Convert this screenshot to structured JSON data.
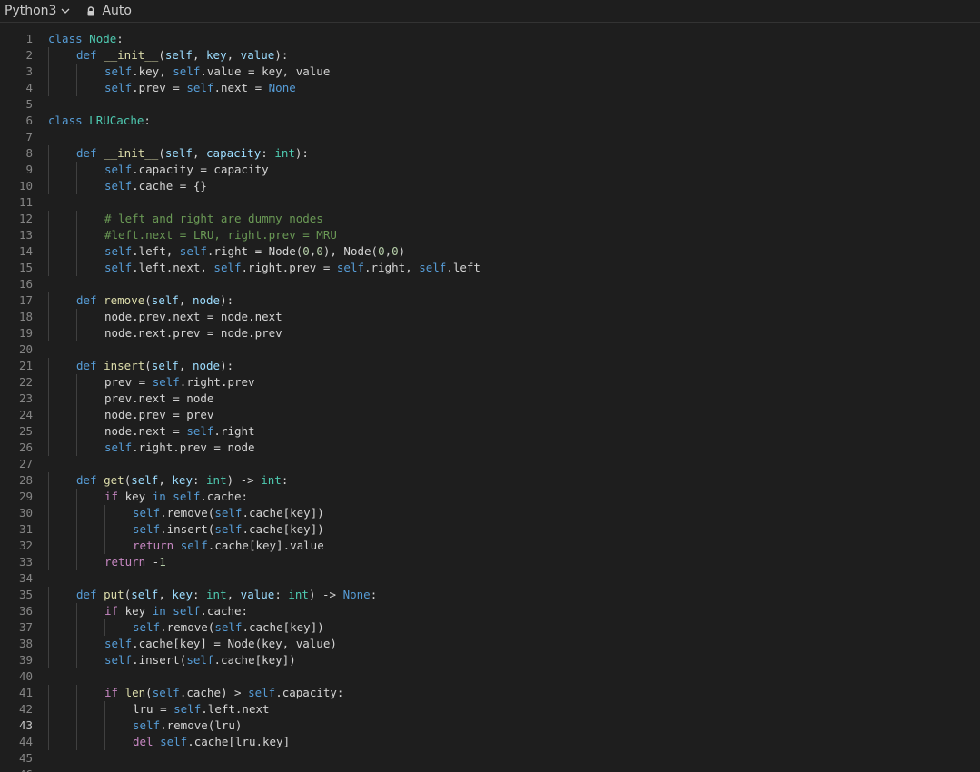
{
  "toolbar": {
    "language": "Python3",
    "mode": "Auto"
  },
  "editor": {
    "active_line": 43,
    "lines": [
      {
        "n": 1,
        "indent": 0,
        "tokens": [
          [
            "kw",
            "class"
          ],
          [
            "",
            ", "
          ],
          [
            "cls",
            "Node"
          ],
          [
            "",
            ":"
          ]
        ]
      },
      {
        "n": 2,
        "indent": 1,
        "tokens": [
          [
            "kw",
            "def"
          ],
          [
            "",
            " "
          ],
          [
            "fn",
            "__init__"
          ],
          [
            "",
            "("
          ],
          [
            "var",
            "self"
          ],
          [
            "",
            ", "
          ],
          [
            "var",
            "key"
          ],
          [
            "",
            ", "
          ],
          [
            "var",
            "value"
          ],
          [
            "",
            "):"
          ]
        ]
      },
      {
        "n": 3,
        "indent": 2,
        "tokens": [
          [
            "self",
            "self"
          ],
          [
            "",
            ".key, "
          ],
          [
            "self",
            "self"
          ],
          [
            "",
            ".value = key, value"
          ]
        ]
      },
      {
        "n": 4,
        "indent": 2,
        "tokens": [
          [
            "self",
            "self"
          ],
          [
            "",
            ".prev = "
          ],
          [
            "self",
            "self"
          ],
          [
            "",
            ".next = "
          ],
          [
            "none",
            "None"
          ]
        ]
      },
      {
        "n": 5,
        "indent": 0,
        "tokens": []
      },
      {
        "n": 6,
        "indent": 0,
        "tokens": [
          [
            "kw",
            "class"
          ],
          [
            "",
            " "
          ],
          [
            "cls",
            "LRUCache"
          ],
          [
            "",
            ":"
          ]
        ]
      },
      {
        "n": 7,
        "indent": 0,
        "tokens": []
      },
      {
        "n": 8,
        "indent": 1,
        "tokens": [
          [
            "kw",
            "def"
          ],
          [
            "",
            " "
          ],
          [
            "fn",
            "__init__"
          ],
          [
            "",
            "("
          ],
          [
            "var",
            "self"
          ],
          [
            "",
            ", "
          ],
          [
            "var",
            "capacity"
          ],
          [
            "",
            ": "
          ],
          [
            "cls",
            "int"
          ],
          [
            "",
            "):"
          ]
        ]
      },
      {
        "n": 9,
        "indent": 2,
        "tokens": [
          [
            "self",
            "self"
          ],
          [
            "",
            ".capacity = capacity"
          ]
        ]
      },
      {
        "n": 10,
        "indent": 2,
        "tokens": [
          [
            "self",
            "self"
          ],
          [
            "",
            ".cache = {}"
          ]
        ]
      },
      {
        "n": 11,
        "indent": 0,
        "tokens": []
      },
      {
        "n": 12,
        "indent": 2,
        "tokens": [
          [
            "cm",
            "# left and right are dummy nodes"
          ]
        ]
      },
      {
        "n": 13,
        "indent": 2,
        "tokens": [
          [
            "cm",
            "#left.next = LRU, right.prev = MRU"
          ]
        ]
      },
      {
        "n": 14,
        "indent": 2,
        "tokens": [
          [
            "self",
            "self"
          ],
          [
            "",
            ".left, "
          ],
          [
            "self",
            "self"
          ],
          [
            "",
            ".right = Node("
          ],
          [
            "num",
            "0"
          ],
          [
            "",
            ","
          ],
          [
            "num",
            "0"
          ],
          [
            "",
            "), Node("
          ],
          [
            "num",
            "0"
          ],
          [
            "",
            ","
          ],
          [
            "num",
            "0"
          ],
          [
            "",
            ")"
          ]
        ]
      },
      {
        "n": 15,
        "indent": 2,
        "tokens": [
          [
            "self",
            "self"
          ],
          [
            "",
            ".left.next, "
          ],
          [
            "self",
            "self"
          ],
          [
            "",
            ".right.prev = "
          ],
          [
            "self",
            "self"
          ],
          [
            "",
            ".right, "
          ],
          [
            "self",
            "self"
          ],
          [
            "",
            ".left"
          ]
        ]
      },
      {
        "n": 16,
        "indent": 0,
        "tokens": []
      },
      {
        "n": 17,
        "indent": 1,
        "tokens": [
          [
            "kw",
            "def"
          ],
          [
            "",
            " "
          ],
          [
            "fn",
            "remove"
          ],
          [
            "",
            "("
          ],
          [
            "var",
            "self"
          ],
          [
            "",
            ", "
          ],
          [
            "var",
            "node"
          ],
          [
            "",
            "):"
          ]
        ]
      },
      {
        "n": 18,
        "indent": 2,
        "tokens": [
          [
            "",
            "node.prev.next = node.next"
          ]
        ]
      },
      {
        "n": 19,
        "indent": 2,
        "tokens": [
          [
            "",
            "node.next.prev = node.prev"
          ]
        ]
      },
      {
        "n": 20,
        "indent": 0,
        "tokens": []
      },
      {
        "n": 21,
        "indent": 1,
        "tokens": [
          [
            "kw",
            "def"
          ],
          [
            "",
            " "
          ],
          [
            "fn",
            "insert"
          ],
          [
            "",
            "("
          ],
          [
            "var",
            "self"
          ],
          [
            "",
            ", "
          ],
          [
            "var",
            "node"
          ],
          [
            "",
            "):"
          ]
        ]
      },
      {
        "n": 22,
        "indent": 2,
        "tokens": [
          [
            "",
            "prev = "
          ],
          [
            "self",
            "self"
          ],
          [
            "",
            ".right.prev"
          ]
        ]
      },
      {
        "n": 23,
        "indent": 2,
        "tokens": [
          [
            "",
            "prev.next = node"
          ]
        ]
      },
      {
        "n": 24,
        "indent": 2,
        "tokens": [
          [
            "",
            "node.prev = prev"
          ]
        ]
      },
      {
        "n": 25,
        "indent": 2,
        "tokens": [
          [
            "",
            "node.next = "
          ],
          [
            "self",
            "self"
          ],
          [
            "",
            ".right"
          ]
        ]
      },
      {
        "n": 26,
        "indent": 2,
        "tokens": [
          [
            "self",
            "self"
          ],
          [
            "",
            ".right.prev = node"
          ]
        ]
      },
      {
        "n": 27,
        "indent": 0,
        "tokens": []
      },
      {
        "n": 28,
        "indent": 1,
        "tokens": [
          [
            "kw",
            "def"
          ],
          [
            "",
            " "
          ],
          [
            "fn",
            "get"
          ],
          [
            "",
            "("
          ],
          [
            "var",
            "self"
          ],
          [
            "",
            ", "
          ],
          [
            "var",
            "key"
          ],
          [
            "",
            ": "
          ],
          [
            "cls",
            "int"
          ],
          [
            "",
            ") -> "
          ],
          [
            "cls",
            "int"
          ],
          [
            "",
            ":"
          ]
        ]
      },
      {
        "n": 29,
        "indent": 2,
        "tokens": [
          [
            "ctl",
            "if"
          ],
          [
            "",
            " key "
          ],
          [
            "kw",
            "in"
          ],
          [
            "",
            " "
          ],
          [
            "self",
            "self"
          ],
          [
            "",
            ".cache:"
          ]
        ]
      },
      {
        "n": 30,
        "indent": 3,
        "tokens": [
          [
            "self",
            "self"
          ],
          [
            "",
            ".remove("
          ],
          [
            "self",
            "self"
          ],
          [
            "",
            ".cache[key])"
          ]
        ]
      },
      {
        "n": 31,
        "indent": 3,
        "tokens": [
          [
            "self",
            "self"
          ],
          [
            "",
            ".insert("
          ],
          [
            "self",
            "self"
          ],
          [
            "",
            ".cache[key])"
          ]
        ]
      },
      {
        "n": 32,
        "indent": 3,
        "tokens": [
          [
            "ctl",
            "return"
          ],
          [
            "",
            " "
          ],
          [
            "self",
            "self"
          ],
          [
            "",
            ".cache[key].value"
          ]
        ]
      },
      {
        "n": 33,
        "indent": 2,
        "tokens": [
          [
            "ctl",
            "return"
          ],
          [
            "",
            " -"
          ],
          [
            "num",
            "1"
          ]
        ]
      },
      {
        "n": 34,
        "indent": 0,
        "tokens": []
      },
      {
        "n": 35,
        "indent": 1,
        "tokens": [
          [
            "kw",
            "def"
          ],
          [
            "",
            " "
          ],
          [
            "fn",
            "put"
          ],
          [
            "",
            "("
          ],
          [
            "var",
            "self"
          ],
          [
            "",
            ", "
          ],
          [
            "var",
            "key"
          ],
          [
            "",
            ": "
          ],
          [
            "cls",
            "int"
          ],
          [
            "",
            ", "
          ],
          [
            "var",
            "value"
          ],
          [
            "",
            ": "
          ],
          [
            "cls",
            "int"
          ],
          [
            "",
            ") -> "
          ],
          [
            "none",
            "None"
          ],
          [
            "",
            ":"
          ]
        ]
      },
      {
        "n": 36,
        "indent": 2,
        "tokens": [
          [
            "ctl",
            "if"
          ],
          [
            "",
            " key "
          ],
          [
            "kw",
            "in"
          ],
          [
            "",
            " "
          ],
          [
            "self",
            "self"
          ],
          [
            "",
            ".cache:"
          ]
        ]
      },
      {
        "n": 37,
        "indent": 3,
        "tokens": [
          [
            "self",
            "self"
          ],
          [
            "",
            ".remove("
          ],
          [
            "self",
            "self"
          ],
          [
            "",
            ".cache[key])"
          ]
        ]
      },
      {
        "n": 38,
        "indent": 2,
        "tokens": [
          [
            "self",
            "self"
          ],
          [
            "",
            ".cache[key] = Node(key, value)"
          ]
        ]
      },
      {
        "n": 39,
        "indent": 2,
        "tokens": [
          [
            "self",
            "self"
          ],
          [
            "",
            ".insert("
          ],
          [
            "self",
            "self"
          ],
          [
            "",
            ".cache[key])"
          ]
        ]
      },
      {
        "n": 40,
        "indent": 0,
        "tokens": []
      },
      {
        "n": 41,
        "indent": 2,
        "tokens": [
          [
            "ctl",
            "if"
          ],
          [
            "",
            " "
          ],
          [
            "fn",
            "len"
          ],
          [
            "",
            "("
          ],
          [
            "self",
            "self"
          ],
          [
            "",
            ".cache) > "
          ],
          [
            "self",
            "self"
          ],
          [
            "",
            ".capacity:"
          ]
        ]
      },
      {
        "n": 42,
        "indent": 3,
        "tokens": [
          [
            "",
            "lru = "
          ],
          [
            "self",
            "self"
          ],
          [
            "",
            ".left.next"
          ]
        ]
      },
      {
        "n": 43,
        "indent": 3,
        "tokens": [
          [
            "self",
            "self"
          ],
          [
            "",
            ".remove(lru)"
          ]
        ]
      },
      {
        "n": 44,
        "indent": 3,
        "tokens": [
          [
            "ctl",
            "del"
          ],
          [
            "",
            " "
          ],
          [
            "self",
            "self"
          ],
          [
            "",
            ".cache[lru.key]"
          ]
        ]
      },
      {
        "n": 45,
        "indent": 0,
        "tokens": []
      },
      {
        "n": 46,
        "indent": 0,
        "tokens": []
      }
    ]
  }
}
